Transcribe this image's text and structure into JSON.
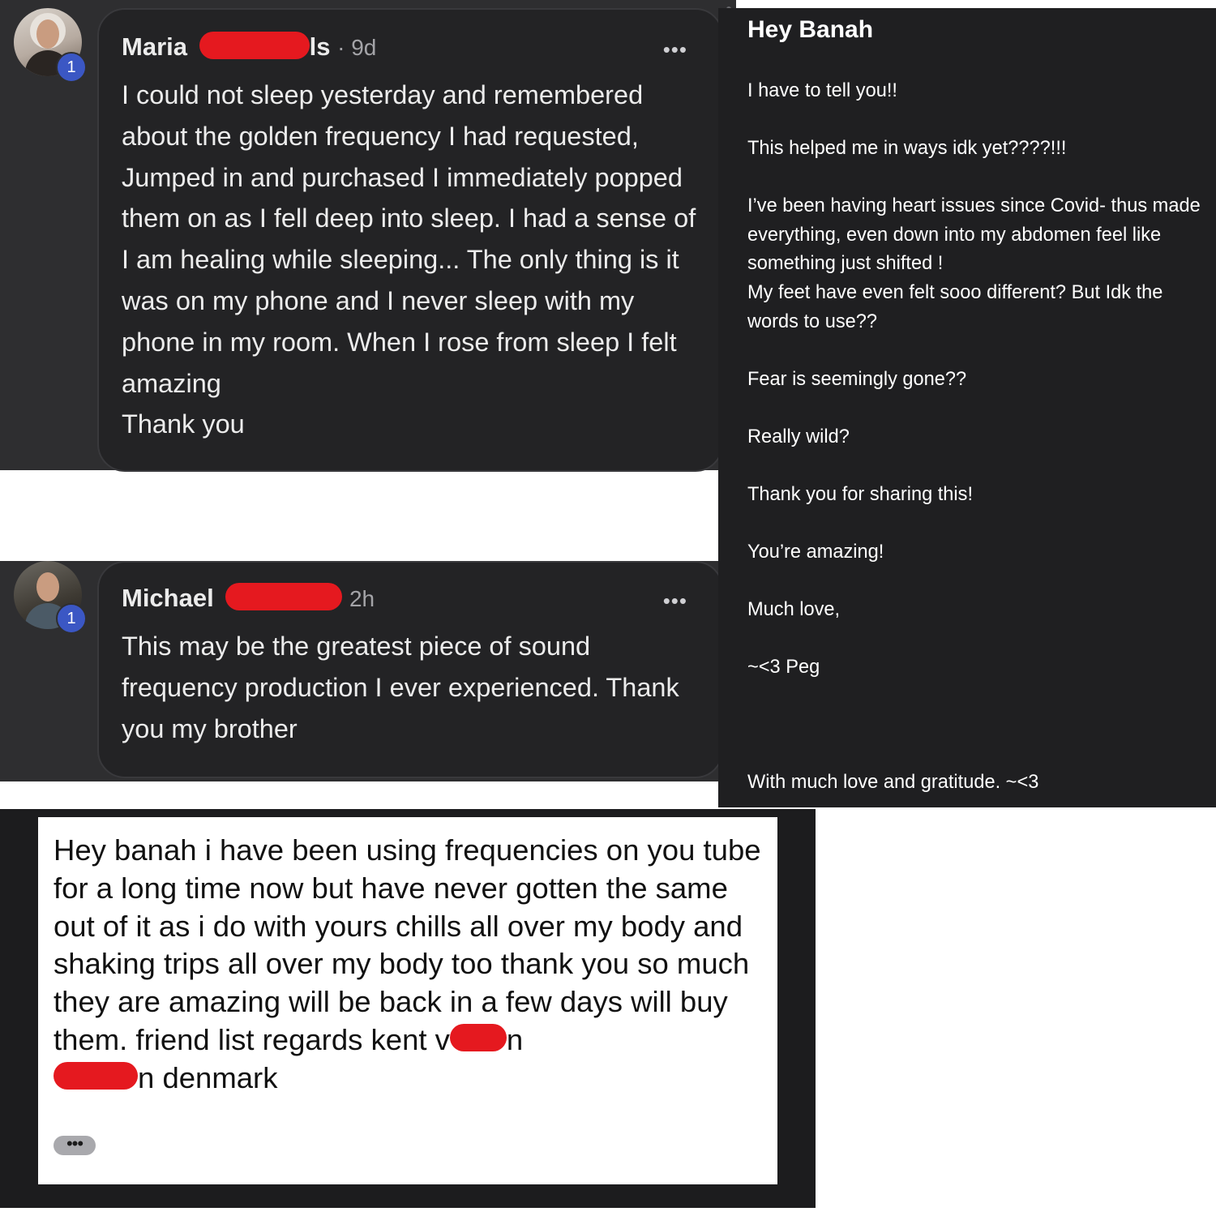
{
  "comments": [
    {
      "name": "Maria",
      "name_visible_tail": "ls",
      "time": "· 9d",
      "badge": "1",
      "more": "•••",
      "body": "I could not sleep yesterday and remembered about the golden frequency I had requested, Jumped in and purchased I immediately popped them on as I fell deep into sleep. I had a sense of I am healing while sleeping... The only thing is it was on my phone and I never sleep with my phone in my room. When I rose from sleep I felt amazing\nThank you"
    },
    {
      "name": "Michael",
      "time": "2h",
      "badge": "1",
      "more": "•••",
      "body": "This may be the greatest piece of sound frequency production I ever experienced. Thank you my brother"
    }
  ],
  "letter": {
    "title": "Hey Banah",
    "lines": [
      "I have to tell you!!",
      "This helped me in ways idk yet????!!!",
      "I’ve been having heart issues since Covid- thus made everything, even down into my abdomen feel like something just shifted !",
      "My feet have even felt sooo different?  But Idk the words to use??",
      "Fear is seemingly gone??",
      "Really wild?",
      "Thank you for sharing this!",
      "You’re amazing!",
      "Much love,",
      "~<3 Peg",
      "With much love and gratitude.  ~<3"
    ]
  },
  "message": {
    "text_part1": "Hey banah i have been using frequencies on you tube for a long time now but have never gotten the same out of it as i do with yours chills all over my body and shaking trips all over my body too thank you so much they are amazing will be back in a few days will buy them. friend list regards kent v",
    "text_part2": "n",
    "text_part3": "n denmark",
    "more": "•••"
  },
  "colors": {
    "panel_bg": "#2e2e30",
    "bubble_bg": "#232325",
    "letter_bg": "#1f1f21",
    "badge": "#3b57c4",
    "redaction": "#e5191f"
  }
}
